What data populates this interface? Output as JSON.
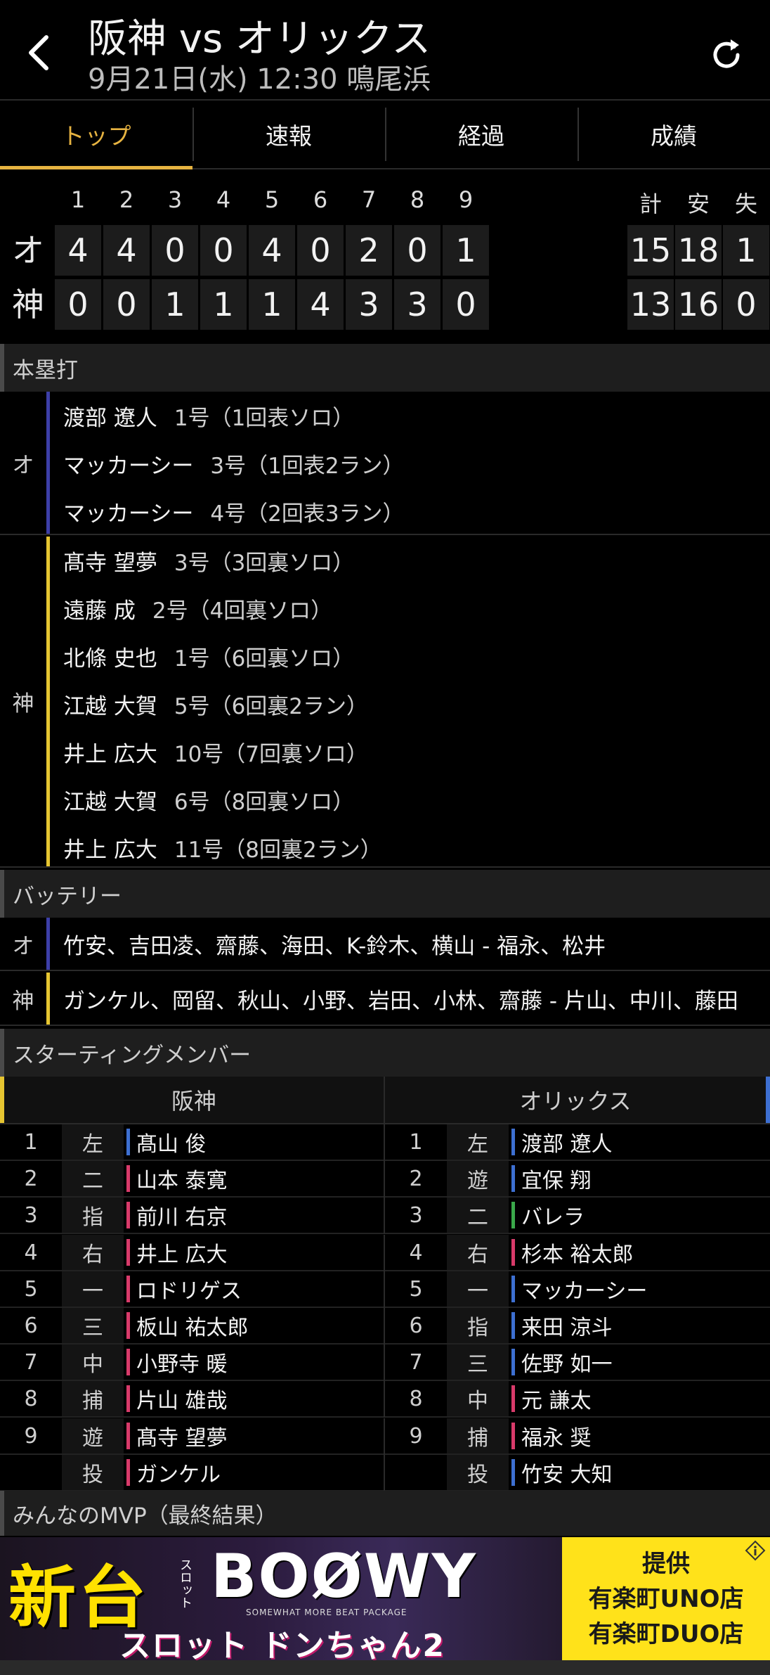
{
  "header": {
    "title": "阪神 vs オリックス",
    "subtitle": "9月21日(水) 12:30 鳴尾浜"
  },
  "tabs": [
    {
      "label": "トップ",
      "active": true
    },
    {
      "label": "速報",
      "active": false
    },
    {
      "label": "経過",
      "active": false
    },
    {
      "label": "成績",
      "active": false
    }
  ],
  "scoreboard": {
    "innings": [
      "1",
      "2",
      "3",
      "4",
      "5",
      "6",
      "7",
      "8",
      "9"
    ],
    "totals_labels": [
      "計",
      "安",
      "失"
    ],
    "teams": [
      {
        "abbr": "オ",
        "scores": [
          "4",
          "4",
          "0",
          "0",
          "4",
          "0",
          "2",
          "0",
          "1"
        ],
        "totals": [
          "15",
          "18",
          "1"
        ]
      },
      {
        "abbr": "神",
        "scores": [
          "0",
          "0",
          "1",
          "1",
          "1",
          "4",
          "3",
          "3",
          "0"
        ],
        "totals": [
          "13",
          "16",
          "0"
        ]
      }
    ]
  },
  "homeruns": {
    "title": "本塁打",
    "groups": [
      {
        "team": "オ",
        "color": "#3d3fa8",
        "items": [
          {
            "name": "渡部 遼人",
            "detail": "1号（1回表ソロ）"
          },
          {
            "name": "マッカーシー",
            "detail": "3号（1回表2ラン）"
          },
          {
            "name": "マッカーシー",
            "detail": "4号（2回表3ラン）"
          }
        ]
      },
      {
        "team": "神",
        "color": "#e6c531",
        "items": [
          {
            "name": "髙寺 望夢",
            "detail": "3号（3回裏ソロ）"
          },
          {
            "name": "遠藤 成",
            "detail": "2号（4回裏ソロ）"
          },
          {
            "name": "北條 史也",
            "detail": "1号（6回裏ソロ）"
          },
          {
            "name": "江越 大賀",
            "detail": "5号（6回裏2ラン）"
          },
          {
            "name": "井上 広大",
            "detail": "10号（7回裏ソロ）"
          },
          {
            "name": "江越 大賀",
            "detail": "6号（8回裏ソロ）"
          },
          {
            "name": "井上 広大",
            "detail": "11号（8回裏2ラン）"
          }
        ]
      }
    ]
  },
  "battery": {
    "title": "バッテリー",
    "rows": [
      {
        "team": "オ",
        "color": "#3d3fa8",
        "text": "竹安、吉田凌、齋藤、海田、K-鈴木、横山 - 福永、松井"
      },
      {
        "team": "神",
        "color": "#e6c531",
        "text": "ガンケル、岡留、秋山、小野、岩田、小林、齋藤 - 片山、中川、藤田"
      }
    ]
  },
  "lineup": {
    "title": "スターティングメンバー",
    "home_team": "阪神",
    "away_team": "オリックス",
    "rows": [
      {
        "num": "1",
        "h_pos": "左",
        "h_name": "髙山 俊",
        "h_color": "#3d6fd1",
        "a_pos": "左",
        "a_name": "渡部 遼人",
        "a_color": "#3d6fd1"
      },
      {
        "num": "2",
        "h_pos": "二",
        "h_name": "山本 泰寛",
        "h_color": "#d83a6a",
        "a_pos": "遊",
        "a_name": "宜保 翔",
        "a_color": "#3d6fd1"
      },
      {
        "num": "3",
        "h_pos": "指",
        "h_name": "前川 右京",
        "h_color": "#d83a6a",
        "a_pos": "二",
        "a_name": "バレラ",
        "a_color": "#3aa84a"
      },
      {
        "num": "4",
        "h_pos": "右",
        "h_name": "井上 広大",
        "h_color": "#d83a6a",
        "a_pos": "右",
        "a_name": "杉本 裕太郎",
        "a_color": "#d83a6a"
      },
      {
        "num": "5",
        "h_pos": "一",
        "h_name": "ロドリゲス",
        "h_color": "#d83a6a",
        "a_pos": "一",
        "a_name": "マッカーシー",
        "a_color": "#3d6fd1"
      },
      {
        "num": "6",
        "h_pos": "三",
        "h_name": "板山 祐太郎",
        "h_color": "#d83a6a",
        "a_pos": "指",
        "a_name": "来田 涼斗",
        "a_color": "#3d6fd1"
      },
      {
        "num": "7",
        "h_pos": "中",
        "h_name": "小野寺 暖",
        "h_color": "#d83a6a",
        "a_pos": "三",
        "a_name": "佐野 如一",
        "a_color": "#3d6fd1"
      },
      {
        "num": "8",
        "h_pos": "捕",
        "h_name": "片山 雄哉",
        "h_color": "#d83a6a",
        "a_pos": "中",
        "a_name": "元 謙太",
        "a_color": "#d83a6a"
      },
      {
        "num": "9",
        "h_pos": "遊",
        "h_name": "髙寺 望夢",
        "h_color": "#d83a6a",
        "a_pos": "捕",
        "a_name": "福永 奨",
        "a_color": "#d83a6a"
      },
      {
        "num": "",
        "h_pos": "投",
        "h_name": "ガンケル",
        "h_color": "#d83a6a",
        "a_pos": "投",
        "a_name": "竹安 大知",
        "a_color": "#3d6fd1"
      }
    ]
  },
  "mvp": {
    "title": "みんなのMVP（最終結果）"
  },
  "banner": {
    "left_big": "新台",
    "left_vertical": "スロット",
    "left_logo": "BOØWY",
    "left_sub": "SOMEWHAT MORE BEAT PACKAGE",
    "left_bottom": "スロット ドンちゃん2",
    "right_lines": [
      "提供",
      "有楽町UNO店",
      "有楽町DUO店"
    ]
  },
  "colors": {
    "accent": "#e6b341",
    "orix": "#3d3fa8",
    "hanshin": "#e6c531"
  }
}
